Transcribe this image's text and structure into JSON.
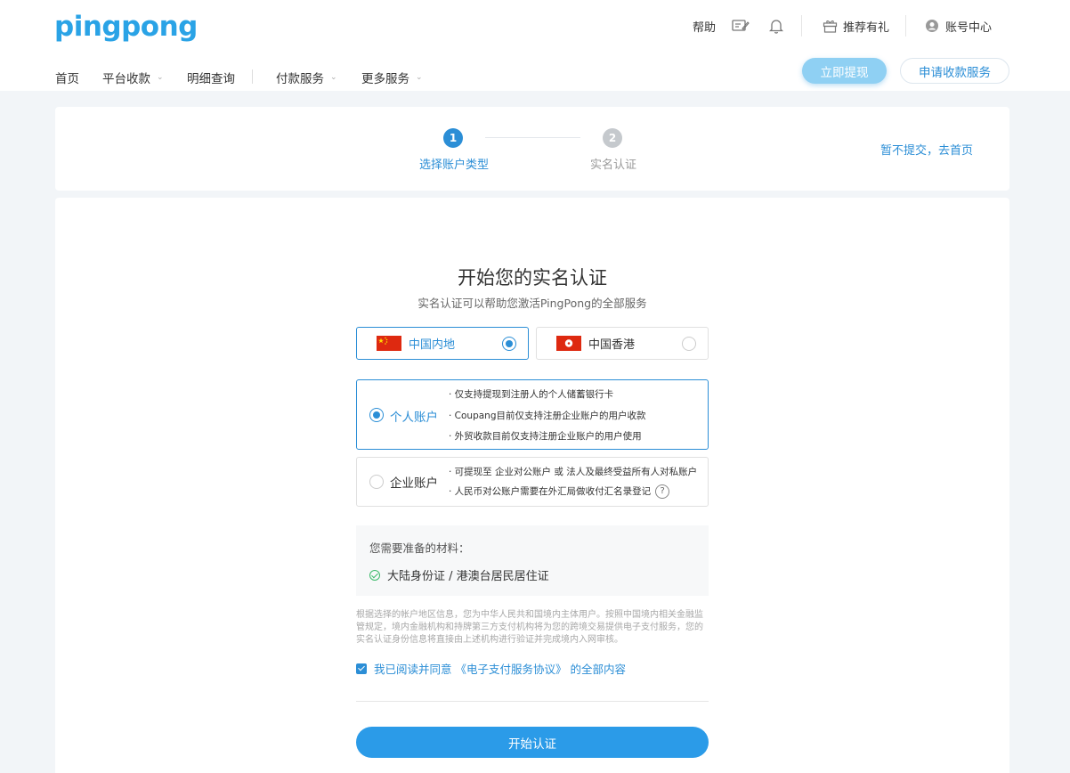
{
  "header": {
    "logo": "pingpong",
    "util": {
      "help": "帮助",
      "edit_icon": "edit-icon",
      "bell_icon": "bell-icon",
      "referral": "推荐有礼",
      "account_center": "账号中心"
    },
    "nav": [
      {
        "label": "首页"
      },
      {
        "label": "平台收款"
      },
      {
        "label": "明细查询"
      },
      {
        "label": "付款服务"
      },
      {
        "label": "更多服务"
      }
    ],
    "withdraw_button": "立即提现",
    "apply_button": "申请收款服务"
  },
  "steps": {
    "items": [
      {
        "number": "1",
        "label": "选择账户类型",
        "active": true
      },
      {
        "number": "2",
        "label": "实名认证",
        "active": false
      }
    ],
    "skip_link": "暂不提交，去首页"
  },
  "main": {
    "title": "开始您的实名认证",
    "subtitle": "实名认证可以帮助您激活PingPong的全部服务",
    "regions": [
      {
        "label": "中国内地",
        "selected": true
      },
      {
        "label": "中国香港",
        "selected": false
      }
    ],
    "accounts": [
      {
        "name": "个人账户",
        "selected": true,
        "notes": [
          "· 仅支持提现到注册人的个人储蓄银行卡",
          "· Coupang目前仅支持注册企业账户的用户收款",
          "· 外贸收款目前仅支持注册企业账户的用户使用"
        ]
      },
      {
        "name": "企业账户",
        "selected": false,
        "notes": [
          "· 可提现至 企业对公账户 或 法人及最终受益所有人对私账户",
          "· 人民币对公账户需要在外汇局做收付汇名录登记"
        ],
        "help_mark": "?"
      }
    ],
    "materials": {
      "title": "您需要准备的材料：",
      "items": [
        "大陆身份证 / 港澳台居民居住证"
      ]
    },
    "disclaimer": "根据选择的帐户地区信息，您为中华人民共和国境内主体用户。按照中国境内相关金融监管规定，境内金融机构和持牌第三方支付机构将为您的跨境交易提供电子支付服务，您的实名认证身份信息将直接由上述机构进行验证并完成境内入网审核。",
    "agreement": "我已阅读并同意 《电子支付服务协议》 的全部内容",
    "agreement_checked": true,
    "start_button": "开始认证"
  },
  "colors": {
    "accent": "#2b8ed6",
    "primary_button": "#2b9be8",
    "logo": "#2aa3e6",
    "withdraw_button": "#8fd0f3",
    "success": "#3cba6a"
  }
}
